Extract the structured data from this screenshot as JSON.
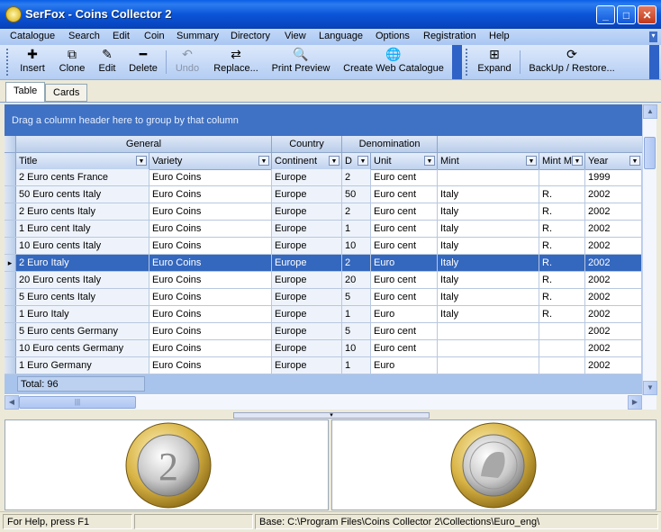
{
  "window": {
    "title": "SerFox - Coins Collector 2",
    "min": "_",
    "max": "□",
    "close": "✕"
  },
  "menu": [
    "Catalogue",
    "Search",
    "Edit",
    "Coin",
    "Summary",
    "Directory",
    "View",
    "Language",
    "Options",
    "Registration",
    "Help"
  ],
  "toolbar": {
    "insert": "Insert",
    "clone": "Clone",
    "edit": "Edit",
    "delete": "Delete",
    "undo": "Undo",
    "replace": "Replace...",
    "print_preview": "Print Preview",
    "create_web": "Create Web Catalogue",
    "expand": "Expand",
    "backup": "BackUp / Restore..."
  },
  "tabs": [
    "Table",
    "Cards"
  ],
  "group_hint": "Drag a column header here to group by that column",
  "bands": {
    "general": "General",
    "country": "Country",
    "denomination": "Denomination"
  },
  "columns": [
    "Title",
    "Variety",
    "Continent",
    "D",
    "Unit",
    "Mint",
    "Mint M",
    "Year"
  ],
  "rows": [
    [
      "2 Euro cents France",
      "Euro Coins",
      "Europe",
      "2",
      "Euro cent",
      "",
      "",
      "1999"
    ],
    [
      "50 Euro cents Italy",
      "Euro Coins",
      "Europe",
      "50",
      "Euro cent",
      "Italy",
      "R.",
      "2002"
    ],
    [
      "2 Euro cents Italy",
      "Euro Coins",
      "Europe",
      "2",
      "Euro cent",
      "Italy",
      "R.",
      "2002"
    ],
    [
      "1 Euro cent Italy",
      "Euro Coins",
      "Europe",
      "1",
      "Euro cent",
      "Italy",
      "R.",
      "2002"
    ],
    [
      "10 Euro cents Italy",
      "Euro Coins",
      "Europe",
      "10",
      "Euro cent",
      "Italy",
      "R.",
      "2002"
    ],
    [
      "2 Euro Italy",
      "Euro Coins",
      "Europe",
      "2",
      "Euro",
      "Italy",
      "R.",
      "2002"
    ],
    [
      "20 Euro cents Italy",
      "Euro Coins",
      "Europe",
      "20",
      "Euro cent",
      "Italy",
      "R.",
      "2002"
    ],
    [
      "5 Euro cents Italy",
      "Euro Coins",
      "Europe",
      "5",
      "Euro cent",
      "Italy",
      "R.",
      "2002"
    ],
    [
      "1 Euro Italy",
      "Euro Coins",
      "Europe",
      "1",
      "Euro",
      "Italy",
      "R.",
      "2002"
    ],
    [
      "5 Euro cents Germany",
      "Euro Coins",
      "Europe",
      "5",
      "Euro cent",
      "",
      "",
      "2002"
    ],
    [
      "10 Euro cents Germany",
      "Euro Coins",
      "Europe",
      "10",
      "Euro cent",
      "",
      "",
      "2002"
    ],
    [
      "1 Euro Germany",
      "Euro Coins",
      "Europe",
      "1",
      "Euro",
      "",
      "",
      "2002"
    ]
  ],
  "selected_row": 5,
  "total": "Total: 96",
  "coin_obverse_text": "2",
  "status": {
    "help": "For Help, press F1",
    "middle": "",
    "base": "Base: C:\\Program Files\\Coins Collector 2\\Collections\\Euro_eng\\"
  }
}
